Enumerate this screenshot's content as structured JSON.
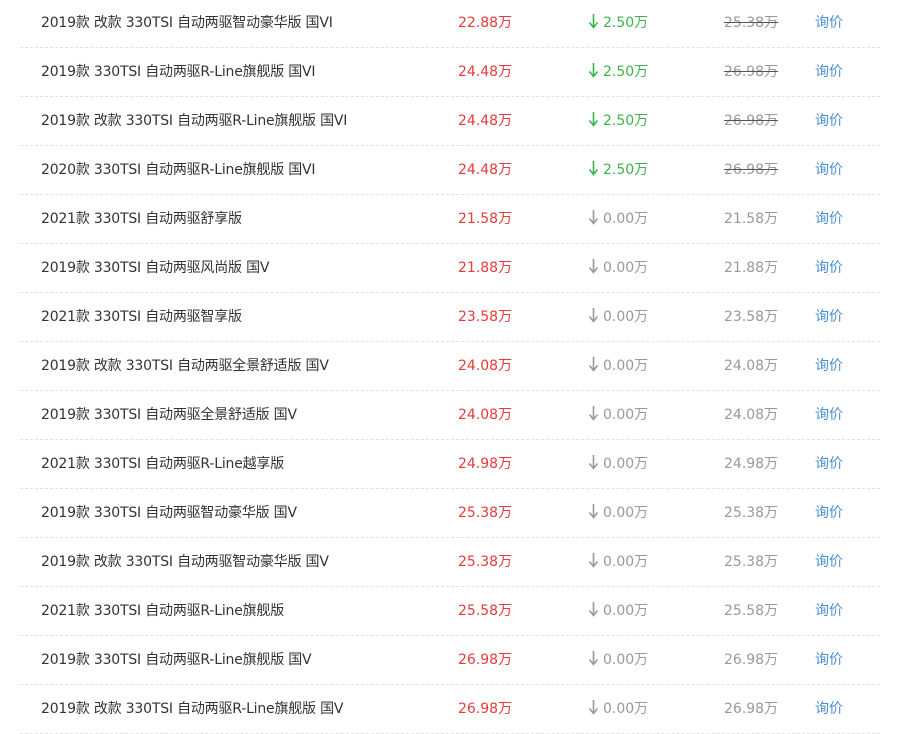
{
  "colors": {
    "price_red": "#e83a3a",
    "drop_green": "#3cb44a",
    "muted_gray": "#999999",
    "link_blue": "#4a8fd4"
  },
  "rows": [
    {
      "name": "2019款 改款 330TSI 自动两驱智动豪华版 国VI",
      "price": "22.88万",
      "drop_icon": "arrow-down-icon",
      "drop": "2.50万",
      "drop_state": "discount",
      "guide": "25.38万",
      "guide_strike": true,
      "action": "询价"
    },
    {
      "name": "2019款 330TSI 自动两驱R-Line旗舰版 国VI",
      "price": "24.48万",
      "drop_icon": "arrow-down-icon",
      "drop": "2.50万",
      "drop_state": "discount",
      "guide": "26.98万",
      "guide_strike": true,
      "action": "询价"
    },
    {
      "name": "2019款 改款 330TSI 自动两驱R-Line旗舰版 国VI",
      "price": "24.48万",
      "drop_icon": "arrow-down-icon",
      "drop": "2.50万",
      "drop_state": "discount",
      "guide": "26.98万",
      "guide_strike": true,
      "action": "询价"
    },
    {
      "name": "2020款 330TSI 自动两驱R-Line旗舰版 国VI",
      "price": "24.48万",
      "drop_icon": "arrow-down-icon",
      "drop": "2.50万",
      "drop_state": "discount",
      "guide": "26.98万",
      "guide_strike": true,
      "action": "询价"
    },
    {
      "name": "2021款 330TSI 自动两驱舒享版",
      "price": "21.58万",
      "drop_icon": "arrow-down-icon",
      "drop": "0.00万",
      "drop_state": "none",
      "guide": "21.58万",
      "guide_strike": false,
      "action": "询价"
    },
    {
      "name": "2019款 330TSI 自动两驱风尚版 国V",
      "price": "21.88万",
      "drop_icon": "arrow-down-icon",
      "drop": "0.00万",
      "drop_state": "none",
      "guide": "21.88万",
      "guide_strike": false,
      "action": "询价"
    },
    {
      "name": "2021款 330TSI 自动两驱智享版",
      "price": "23.58万",
      "drop_icon": "arrow-down-icon",
      "drop": "0.00万",
      "drop_state": "none",
      "guide": "23.58万",
      "guide_strike": false,
      "action": "询价"
    },
    {
      "name": "2019款 改款 330TSI 自动两驱全景舒适版 国V",
      "price": "24.08万",
      "drop_icon": "arrow-down-icon",
      "drop": "0.00万",
      "drop_state": "none",
      "guide": "24.08万",
      "guide_strike": false,
      "action": "询价"
    },
    {
      "name": "2019款 330TSI 自动两驱全景舒适版 国V",
      "price": "24.08万",
      "drop_icon": "arrow-down-icon",
      "drop": "0.00万",
      "drop_state": "none",
      "guide": "24.08万",
      "guide_strike": false,
      "action": "询价"
    },
    {
      "name": "2021款 330TSI 自动两驱R-Line越享版",
      "price": "24.98万",
      "drop_icon": "arrow-down-icon",
      "drop": "0.00万",
      "drop_state": "none",
      "guide": "24.98万",
      "guide_strike": false,
      "action": "询价"
    },
    {
      "name": "2019款 330TSI 自动两驱智动豪华版 国V",
      "price": "25.38万",
      "drop_icon": "arrow-down-icon",
      "drop": "0.00万",
      "drop_state": "none",
      "guide": "25.38万",
      "guide_strike": false,
      "action": "询价"
    },
    {
      "name": "2019款 改款 330TSI 自动两驱智动豪华版 国V",
      "price": "25.38万",
      "drop_icon": "arrow-down-icon",
      "drop": "0.00万",
      "drop_state": "none",
      "guide": "25.38万",
      "guide_strike": false,
      "action": "询价"
    },
    {
      "name": "2021款 330TSI 自动两驱R-Line旗舰版",
      "price": "25.58万",
      "drop_icon": "arrow-down-icon",
      "drop": "0.00万",
      "drop_state": "none",
      "guide": "25.58万",
      "guide_strike": false,
      "action": "询价"
    },
    {
      "name": "2019款 330TSI 自动两驱R-Line旗舰版 国V",
      "price": "26.98万",
      "drop_icon": "arrow-down-icon",
      "drop": "0.00万",
      "drop_state": "none",
      "guide": "26.98万",
      "guide_strike": false,
      "action": "询价"
    },
    {
      "name": "2019款 改款 330TSI 自动两驱R-Line旗舰版 国V",
      "price": "26.98万",
      "drop_icon": "arrow-down-icon",
      "drop": "0.00万",
      "drop_state": "none",
      "guide": "26.98万",
      "guide_strike": false,
      "action": "询价"
    }
  ]
}
